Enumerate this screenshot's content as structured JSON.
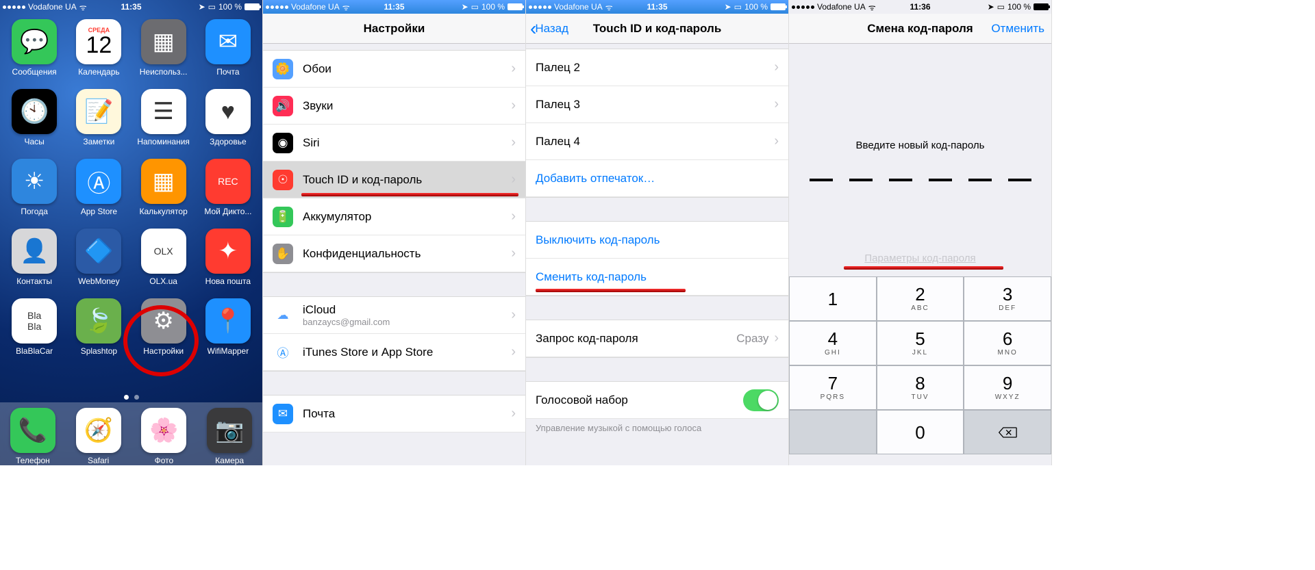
{
  "status": {
    "carrier": "Vodafone UA",
    "time1": "11:35",
    "time4": "11:36",
    "battery": "100 %"
  },
  "home": {
    "apps": [
      {
        "label": "Сообщения",
        "bg": "#34c759",
        "glyph": "💬"
      },
      {
        "label": "Календарь",
        "bg": "#ffffff",
        "top": "СРЕДА",
        "num": "12"
      },
      {
        "label": "Неиспольз...",
        "bg": "#6c6c70",
        "glyph": "▦"
      },
      {
        "label": "Почта",
        "bg": "#1e90ff",
        "glyph": "✉"
      },
      {
        "label": "Часы",
        "bg": "#000000",
        "glyph": "🕙"
      },
      {
        "label": "Заметки",
        "bg": "#fff8dc",
        "glyph": "📝"
      },
      {
        "label": "Напоминания",
        "bg": "#ffffff",
        "glyph": "☰"
      },
      {
        "label": "Здоровье",
        "bg": "#ffffff",
        "glyph": "♥"
      },
      {
        "label": "Погода",
        "bg": "#2e86de",
        "glyph": "☀"
      },
      {
        "label": "App Store",
        "bg": "#1e90ff",
        "glyph": "Ⓐ"
      },
      {
        "label": "Калькулятор",
        "bg": "#ff9500",
        "glyph": "▦"
      },
      {
        "label": "Мой Дикто...",
        "bg": "#ff3b30",
        "glyph": "REC"
      },
      {
        "label": "Контакты",
        "bg": "#d7d7d9",
        "glyph": "👤"
      },
      {
        "label": "WebMoney",
        "bg": "#2b5aa6",
        "glyph": "🔷"
      },
      {
        "label": "OLX.ua",
        "bg": "#ffffff",
        "glyph": "OLX"
      },
      {
        "label": "Нова пошта",
        "bg": "#ff3b30",
        "glyph": "✦"
      },
      {
        "label": "BlaBlaCar",
        "bg": "#ffffff",
        "glyph": "Bla\nBla"
      },
      {
        "label": "Splashtop",
        "bg": "#6ab04c",
        "glyph": "🍃"
      },
      {
        "label": "Настройки",
        "bg": "#8e8e93",
        "glyph": "⚙"
      },
      {
        "label": "WifiMapper",
        "bg": "#1e90ff",
        "glyph": "📍"
      }
    ],
    "dock": [
      {
        "label": "Телефон",
        "bg": "#34c759",
        "glyph": "📞"
      },
      {
        "label": "Safari",
        "bg": "#ffffff",
        "glyph": "🧭"
      },
      {
        "label": "Фото",
        "bg": "#ffffff",
        "glyph": "🌸"
      },
      {
        "label": "Камера",
        "bg": "#3a3a3c",
        "glyph": "📷"
      }
    ]
  },
  "settings": {
    "title": "Настройки",
    "rows": [
      {
        "icon_bg": "#54a0ff",
        "glyph": "🌼",
        "label": "Обои"
      },
      {
        "icon_bg": "#ff2d55",
        "glyph": "🔊",
        "label": "Звуки"
      },
      {
        "icon_bg": "#000000",
        "glyph": "◉",
        "label": "Siri"
      },
      {
        "icon_bg": "#ff3b30",
        "glyph": "☉",
        "label": "Touch ID и код-пароль",
        "selected": true,
        "underline": true
      },
      {
        "icon_bg": "#34c759",
        "glyph": "🔋",
        "label": "Аккумулятор"
      },
      {
        "icon_bg": "#8e8e93",
        "glyph": "✋",
        "label": "Конфиденциальность"
      }
    ],
    "group2": [
      {
        "icon_bg": "#ffffff",
        "glyph": "☁",
        "label": "iCloud",
        "sub": "banzaycs@gmail.com",
        "icon_fg": "#54a0ff"
      },
      {
        "icon_bg": "#ffffff",
        "glyph": "Ⓐ",
        "label": "iTunes Store и App Store",
        "icon_fg": "#1e90ff"
      }
    ],
    "group3": [
      {
        "icon_bg": "#1e90ff",
        "glyph": "✉",
        "label": "Почта"
      }
    ]
  },
  "touchid": {
    "back": "Назад",
    "title": "Touch ID и код-пароль",
    "fingers": [
      "Палец 2",
      "Палец 3",
      "Палец 4"
    ],
    "add": "Добавить отпечаток…",
    "turnoff": "Выключить код-пароль",
    "change": "Сменить код-пароль",
    "request_label": "Запрос код-пароля",
    "request_value": "Сразу",
    "voice": "Голосовой набор",
    "voice_note": "Управление музыкой с помощью голоса"
  },
  "passcode": {
    "title": "Смена код-пароля",
    "cancel": "Отменить",
    "prompt": "Введите новый код-пароль",
    "options": "Параметры код-пароля",
    "keys": [
      {
        "n": "1",
        "l": ""
      },
      {
        "n": "2",
        "l": "ABC"
      },
      {
        "n": "3",
        "l": "DEF"
      },
      {
        "n": "4",
        "l": "GHI"
      },
      {
        "n": "5",
        "l": "JKL"
      },
      {
        "n": "6",
        "l": "MNO"
      },
      {
        "n": "7",
        "l": "PQRS"
      },
      {
        "n": "8",
        "l": "TUV"
      },
      {
        "n": "9",
        "l": "WXYZ"
      },
      {
        "n": "",
        "l": "",
        "gray": true
      },
      {
        "n": "0",
        "l": ""
      },
      {
        "n": "",
        "l": "",
        "gray": true,
        "del": true
      }
    ]
  }
}
